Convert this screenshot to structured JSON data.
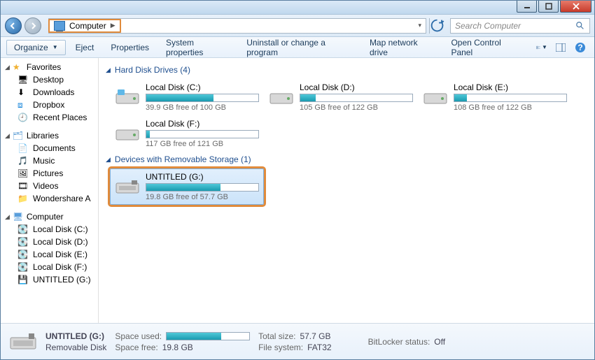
{
  "breadcrumb": {
    "location": "Computer"
  },
  "search": {
    "placeholder": "Search Computer"
  },
  "toolbar": {
    "organize": "Organize",
    "eject": "Eject",
    "properties": "Properties",
    "system_properties": "System properties",
    "uninstall": "Uninstall or change a program",
    "map_drive": "Map network drive",
    "control_panel": "Open Control Panel"
  },
  "sidebar": {
    "favorites": {
      "label": "Favorites",
      "items": [
        {
          "label": "Desktop"
        },
        {
          "label": "Downloads"
        },
        {
          "label": "Dropbox"
        },
        {
          "label": "Recent Places"
        }
      ]
    },
    "libraries": {
      "label": "Libraries",
      "items": [
        {
          "label": "Documents"
        },
        {
          "label": "Music"
        },
        {
          "label": "Pictures"
        },
        {
          "label": "Videos"
        },
        {
          "label": "Wondershare A"
        }
      ]
    },
    "computer": {
      "label": "Computer",
      "items": [
        {
          "label": "Local Disk (C:)"
        },
        {
          "label": "Local Disk (D:)"
        },
        {
          "label": "Local Disk (E:)"
        },
        {
          "label": "Local Disk (F:)"
        },
        {
          "label": "UNTITLED (G:)"
        }
      ]
    }
  },
  "sections": {
    "hdd": {
      "label": "Hard Disk Drives (4)",
      "drives": [
        {
          "name": "Local Disk (C:)",
          "free_text": "39.9 GB free of 100 GB",
          "used_pct": 60
        },
        {
          "name": "Local Disk (D:)",
          "free_text": "105 GB free of 122 GB",
          "used_pct": 14
        },
        {
          "name": "Local Disk (E:)",
          "free_text": "108 GB free of 122 GB",
          "used_pct": 11
        },
        {
          "name": "Local Disk (F:)",
          "free_text": "117 GB free of 121 GB",
          "used_pct": 3
        }
      ]
    },
    "removable": {
      "label": "Devices with Removable Storage (1)",
      "drives": [
        {
          "name": "UNTITLED (G:)",
          "free_text": "19.8 GB free of 57.7 GB",
          "used_pct": 66
        }
      ]
    }
  },
  "details": {
    "title": "UNTITLED (G:)",
    "subtitle": "Removable Disk",
    "space_used_label": "Space used:",
    "space_free_label": "Space free:",
    "space_free": "19.8 GB",
    "total_label": "Total size:",
    "total": "57.7 GB",
    "fs_label": "File system:",
    "fs": "FAT32",
    "bitlocker_label": "BitLocker status:",
    "bitlocker": "Off",
    "used_pct": 66
  }
}
